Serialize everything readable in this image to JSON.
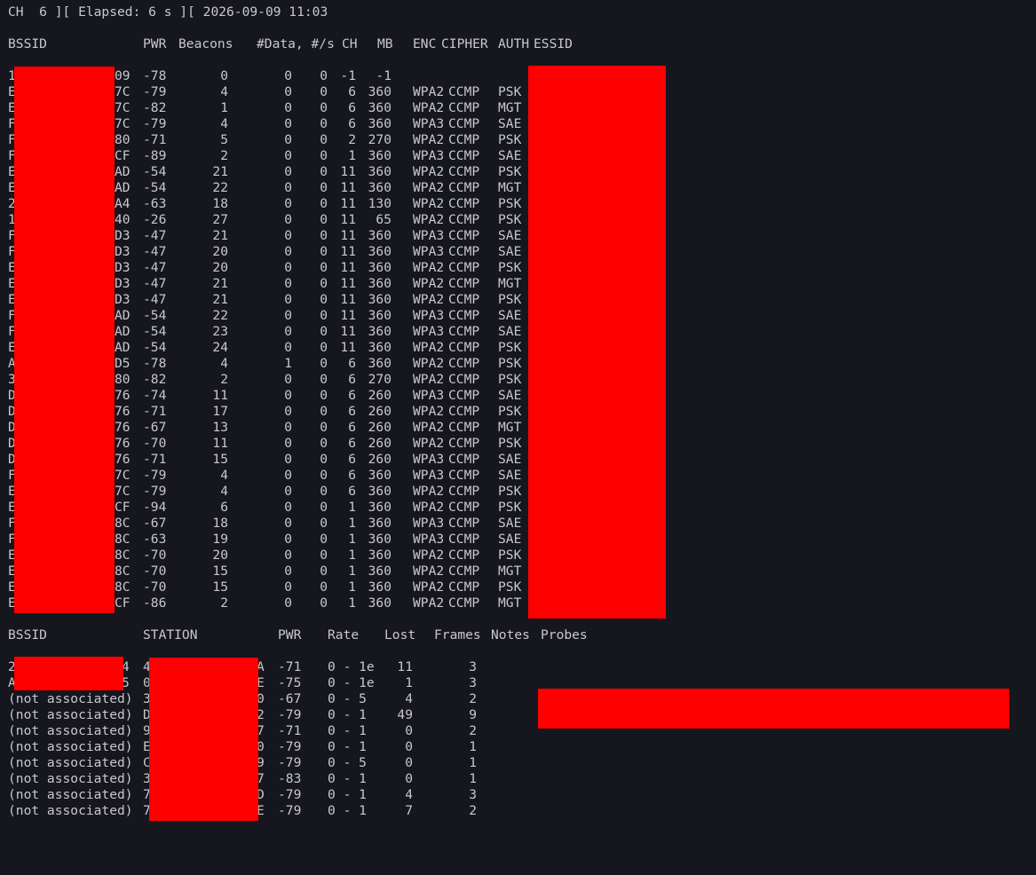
{
  "status_line": "CH  6 ][ Elapsed: 6 s ][ 2026-09-09 11:03",
  "ap_header": {
    "bssid": "BSSID",
    "pwr": "PWR",
    "beacons": "Beacons",
    "data": "#Data, #/s",
    "ch": "CH",
    "mb": "MB",
    "enc": "ENC",
    "cipher": "CIPHER",
    "auth": "AUTH",
    "essid": "ESSID"
  },
  "access_points": [
    {
      "bssid_prefix": "1",
      "bssid_suffix": "09",
      "pwr": "-78",
      "beacons": "0",
      "data": "0",
      "rate": "0",
      "ch": "-1",
      "mb": "-1",
      "enc": "",
      "cipher": "",
      "auth": ""
    },
    {
      "bssid_prefix": "E",
      "bssid_suffix": "7C",
      "pwr": "-79",
      "beacons": "4",
      "data": "0",
      "rate": "0",
      "ch": "6",
      "mb": "360",
      "enc": "WPA2",
      "cipher": "CCMP",
      "auth": "PSK"
    },
    {
      "bssid_prefix": "E",
      "bssid_suffix": "7C",
      "pwr": "-82",
      "beacons": "1",
      "data": "0",
      "rate": "0",
      "ch": "6",
      "mb": "360",
      "enc": "WPA2",
      "cipher": "CCMP",
      "auth": "MGT"
    },
    {
      "bssid_prefix": "F",
      "bssid_suffix": "7C",
      "pwr": "-79",
      "beacons": "4",
      "data": "0",
      "rate": "0",
      "ch": "6",
      "mb": "360",
      "enc": "WPA3",
      "cipher": "CCMP",
      "auth": "SAE"
    },
    {
      "bssid_prefix": "F",
      "bssid_suffix": "80",
      "pwr": "-71",
      "beacons": "5",
      "data": "0",
      "rate": "0",
      "ch": "2",
      "mb": "270",
      "enc": "WPA2",
      "cipher": "CCMP",
      "auth": "PSK"
    },
    {
      "bssid_prefix": "F",
      "bssid_suffix": "CF",
      "pwr": "-89",
      "beacons": "2",
      "data": "0",
      "rate": "0",
      "ch": "1",
      "mb": "360",
      "enc": "WPA3",
      "cipher": "CCMP",
      "auth": "SAE"
    },
    {
      "bssid_prefix": "E",
      "bssid_suffix": "AD",
      "pwr": "-54",
      "beacons": "21",
      "data": "0",
      "rate": "0",
      "ch": "11",
      "mb": "360",
      "enc": "WPA2",
      "cipher": "CCMP",
      "auth": "PSK"
    },
    {
      "bssid_prefix": "E",
      "bssid_suffix": "AD",
      "pwr": "-54",
      "beacons": "22",
      "data": "0",
      "rate": "0",
      "ch": "11",
      "mb": "360",
      "enc": "WPA2",
      "cipher": "CCMP",
      "auth": "MGT"
    },
    {
      "bssid_prefix": "2",
      "bssid_suffix": "A4",
      "pwr": "-63",
      "beacons": "18",
      "data": "0",
      "rate": "0",
      "ch": "11",
      "mb": "130",
      "enc": "WPA2",
      "cipher": "CCMP",
      "auth": "PSK"
    },
    {
      "bssid_prefix": "1",
      "bssid_suffix": "40",
      "pwr": "-26",
      "beacons": "27",
      "data": "0",
      "rate": "0",
      "ch": "11",
      "mb": "65",
      "enc": "WPA2",
      "cipher": "CCMP",
      "auth": "PSK"
    },
    {
      "bssid_prefix": "F",
      "bssid_suffix": "D3",
      "pwr": "-47",
      "beacons": "21",
      "data": "0",
      "rate": "0",
      "ch": "11",
      "mb": "360",
      "enc": "WPA3",
      "cipher": "CCMP",
      "auth": "SAE"
    },
    {
      "bssid_prefix": "F",
      "bssid_suffix": "D3",
      "pwr": "-47",
      "beacons": "20",
      "data": "0",
      "rate": "0",
      "ch": "11",
      "mb": "360",
      "enc": "WPA3",
      "cipher": "CCMP",
      "auth": "SAE"
    },
    {
      "bssid_prefix": "E",
      "bssid_suffix": "D3",
      "pwr": "-47",
      "beacons": "20",
      "data": "0",
      "rate": "0",
      "ch": "11",
      "mb": "360",
      "enc": "WPA2",
      "cipher": "CCMP",
      "auth": "PSK"
    },
    {
      "bssid_prefix": "E",
      "bssid_suffix": "D3",
      "pwr": "-47",
      "beacons": "21",
      "data": "0",
      "rate": "0",
      "ch": "11",
      "mb": "360",
      "enc": "WPA2",
      "cipher": "CCMP",
      "auth": "MGT"
    },
    {
      "bssid_prefix": "E",
      "bssid_suffix": "D3",
      "pwr": "-47",
      "beacons": "21",
      "data": "0",
      "rate": "0",
      "ch": "11",
      "mb": "360",
      "enc": "WPA2",
      "cipher": "CCMP",
      "auth": "PSK"
    },
    {
      "bssid_prefix": "F",
      "bssid_suffix": "AD",
      "pwr": "-54",
      "beacons": "22",
      "data": "0",
      "rate": "0",
      "ch": "11",
      "mb": "360",
      "enc": "WPA3",
      "cipher": "CCMP",
      "auth": "SAE"
    },
    {
      "bssid_prefix": "F",
      "bssid_suffix": "AD",
      "pwr": "-54",
      "beacons": "23",
      "data": "0",
      "rate": "0",
      "ch": "11",
      "mb": "360",
      "enc": "WPA3",
      "cipher": "CCMP",
      "auth": "SAE"
    },
    {
      "bssid_prefix": "E",
      "bssid_suffix": "AD",
      "pwr": "-54",
      "beacons": "24",
      "data": "0",
      "rate": "0",
      "ch": "11",
      "mb": "360",
      "enc": "WPA2",
      "cipher": "CCMP",
      "auth": "PSK"
    },
    {
      "bssid_prefix": "A",
      "bssid_suffix": "D5",
      "pwr": "-78",
      "beacons": "4",
      "data": "1",
      "rate": "0",
      "ch": "6",
      "mb": "360",
      "enc": "WPA2",
      "cipher": "CCMP",
      "auth": "PSK"
    },
    {
      "bssid_prefix": "3",
      "bssid_suffix": "80",
      "pwr": "-82",
      "beacons": "2",
      "data": "0",
      "rate": "0",
      "ch": "6",
      "mb": "270",
      "enc": "WPA2",
      "cipher": "CCMP",
      "auth": "PSK"
    },
    {
      "bssid_prefix": "D",
      "bssid_suffix": "76",
      "pwr": "-74",
      "beacons": "11",
      "data": "0",
      "rate": "0",
      "ch": "6",
      "mb": "260",
      "enc": "WPA3",
      "cipher": "CCMP",
      "auth": "SAE"
    },
    {
      "bssid_prefix": "D",
      "bssid_suffix": "76",
      "pwr": "-71",
      "beacons": "17",
      "data": "0",
      "rate": "0",
      "ch": "6",
      "mb": "260",
      "enc": "WPA2",
      "cipher": "CCMP",
      "auth": "PSK"
    },
    {
      "bssid_prefix": "D",
      "bssid_suffix": "76",
      "pwr": "-67",
      "beacons": "13",
      "data": "0",
      "rate": "0",
      "ch": "6",
      "mb": "260",
      "enc": "WPA2",
      "cipher": "CCMP",
      "auth": "MGT"
    },
    {
      "bssid_prefix": "D",
      "bssid_suffix": "76",
      "pwr": "-70",
      "beacons": "11",
      "data": "0",
      "rate": "0",
      "ch": "6",
      "mb": "260",
      "enc": "WPA2",
      "cipher": "CCMP",
      "auth": "PSK"
    },
    {
      "bssid_prefix": "D",
      "bssid_suffix": "76",
      "pwr": "-71",
      "beacons": "15",
      "data": "0",
      "rate": "0",
      "ch": "6",
      "mb": "260",
      "enc": "WPA3",
      "cipher": "CCMP",
      "auth": "SAE"
    },
    {
      "bssid_prefix": "F",
      "bssid_suffix": "7C",
      "pwr": "-79",
      "beacons": "4",
      "data": "0",
      "rate": "0",
      "ch": "6",
      "mb": "360",
      "enc": "WPA3",
      "cipher": "CCMP",
      "auth": "SAE"
    },
    {
      "bssid_prefix": "E",
      "bssid_suffix": "7C",
      "pwr": "-79",
      "beacons": "4",
      "data": "0",
      "rate": "0",
      "ch": "6",
      "mb": "360",
      "enc": "WPA2",
      "cipher": "CCMP",
      "auth": "PSK"
    },
    {
      "bssid_prefix": "E",
      "bssid_suffix": "CF",
      "pwr": "-94",
      "beacons": "6",
      "data": "0",
      "rate": "0",
      "ch": "1",
      "mb": "360",
      "enc": "WPA2",
      "cipher": "CCMP",
      "auth": "PSK"
    },
    {
      "bssid_prefix": "F",
      "bssid_suffix": "8C",
      "pwr": "-67",
      "beacons": "18",
      "data": "0",
      "rate": "0",
      "ch": "1",
      "mb": "360",
      "enc": "WPA3",
      "cipher": "CCMP",
      "auth": "SAE"
    },
    {
      "bssid_prefix": "F",
      "bssid_suffix": "8C",
      "pwr": "-63",
      "beacons": "19",
      "data": "0",
      "rate": "0",
      "ch": "1",
      "mb": "360",
      "enc": "WPA3",
      "cipher": "CCMP",
      "auth": "SAE"
    },
    {
      "bssid_prefix": "E",
      "bssid_suffix": "8C",
      "pwr": "-70",
      "beacons": "20",
      "data": "0",
      "rate": "0",
      "ch": "1",
      "mb": "360",
      "enc": "WPA2",
      "cipher": "CCMP",
      "auth": "PSK"
    },
    {
      "bssid_prefix": "E",
      "bssid_suffix": "8C",
      "pwr": "-70",
      "beacons": "15",
      "data": "0",
      "rate": "0",
      "ch": "1",
      "mb": "360",
      "enc": "WPA2",
      "cipher": "CCMP",
      "auth": "MGT"
    },
    {
      "bssid_prefix": "E",
      "bssid_suffix": "8C",
      "pwr": "-70",
      "beacons": "15",
      "data": "0",
      "rate": "0",
      "ch": "1",
      "mb": "360",
      "enc": "WPA2",
      "cipher": "CCMP",
      "auth": "PSK"
    },
    {
      "bssid_prefix": "E",
      "bssid_suffix": "CF",
      "pwr": "-86",
      "beacons": "2",
      "data": "0",
      "rate": "0",
      "ch": "1",
      "mb": "360",
      "enc": "WPA2",
      "cipher": "CCMP",
      "auth": "MGT"
    }
  ],
  "station_header": {
    "bssid": "BSSID",
    "station": "STATION",
    "pwr": "PWR",
    "rate": "Rate",
    "lost": "Lost",
    "frames": "Frames",
    "notes": "Notes",
    "probes": "Probes"
  },
  "stations": [
    {
      "bssid": "2",
      "bssid_suffix": "4",
      "station_prefix": "4",
      "station_suffix": "A",
      "pwr": "-71",
      "rate": "0 - 1e",
      "lost": "11",
      "frames": "3"
    },
    {
      "bssid": "A",
      "bssid_suffix": "5",
      "station_prefix": "0",
      "station_suffix": "E",
      "pwr": "-75",
      "rate": "0 - 1e",
      "lost": "1",
      "frames": "3"
    },
    {
      "bssid": "(not associated)",
      "bssid_suffix": "",
      "station_prefix": "3",
      "station_suffix": "0",
      "pwr": "-67",
      "rate": "0 - 5",
      "lost": "4",
      "frames": "2"
    },
    {
      "bssid": "(not associated)",
      "bssid_suffix": "",
      "station_prefix": "D",
      "station_suffix": "2",
      "pwr": "-79",
      "rate": "0 - 1",
      "lost": "49",
      "frames": "9"
    },
    {
      "bssid": "(not associated)",
      "bssid_suffix": "",
      "station_prefix": "9",
      "station_suffix": "7",
      "pwr": "-71",
      "rate": "0 - 1",
      "lost": "0",
      "frames": "2"
    },
    {
      "bssid": "(not associated)",
      "bssid_suffix": "",
      "station_prefix": "E",
      "station_suffix": "0",
      "pwr": "-79",
      "rate": "0 - 1",
      "lost": "0",
      "frames": "1"
    },
    {
      "bssid": "(not associated)",
      "bssid_suffix": "",
      "station_prefix": "C",
      "station_suffix": "9",
      "pwr": "-79",
      "rate": "0 - 5",
      "lost": "0",
      "frames": "1"
    },
    {
      "bssid": "(not associated)",
      "bssid_suffix": "",
      "station_prefix": "3",
      "station_suffix": "7",
      "pwr": "-83",
      "rate": "0 - 1",
      "lost": "0",
      "frames": "1"
    },
    {
      "bssid": "(not associated)",
      "bssid_suffix": "",
      "station_prefix": "7",
      "station_suffix": "D",
      "pwr": "-79",
      "rate": "0 - 1",
      "lost": "4",
      "frames": "3"
    },
    {
      "bssid": "(not associated)",
      "bssid_suffix": "",
      "station_prefix": "7",
      "station_suffix": "E",
      "pwr": "-79",
      "rate": "0 - 1",
      "lost": "7",
      "frames": "2"
    }
  ],
  "colors": {
    "background": "#16161f",
    "text": "#c8c8cc",
    "redaction": "#ff0000"
  }
}
